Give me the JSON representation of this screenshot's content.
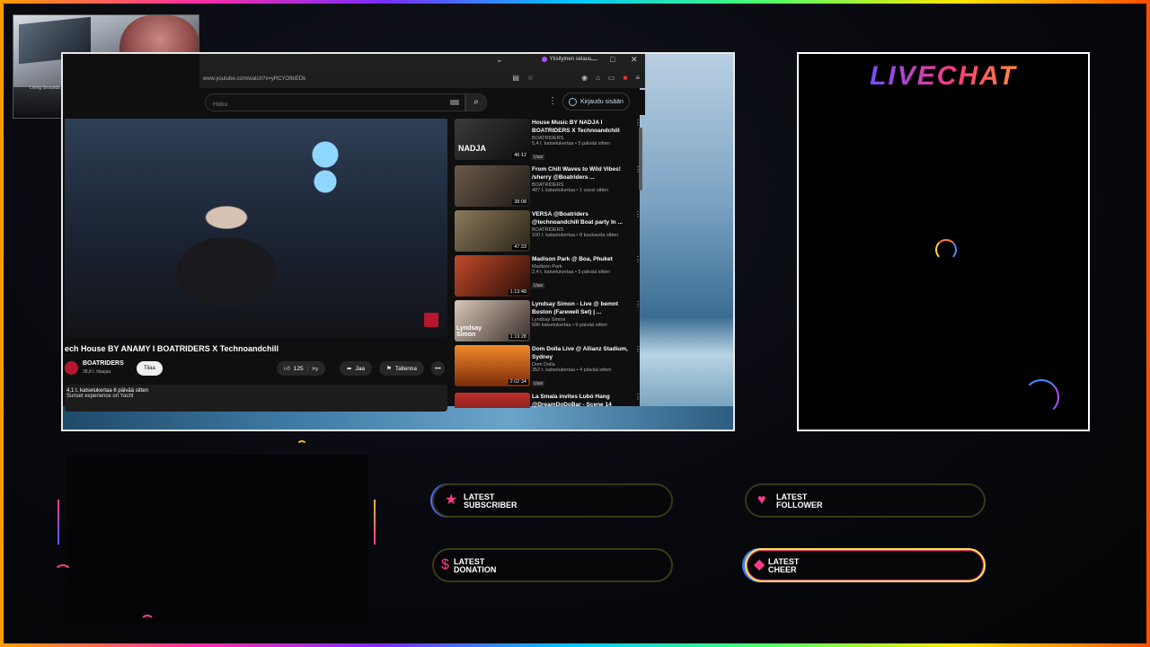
{
  "webcam": {
    "caption": "Living Grounds"
  },
  "browser": {
    "title_bar": {
      "private_label": "Yksityinen selaus",
      "minimize": "—",
      "maximize": "□",
      "close": "✕"
    },
    "address": {
      "url": "www.youtube.com/watch?v=yRCYOfbIEDk"
    },
    "search": {
      "placeholder": "Haku"
    },
    "signin_label": "Kirjaudu sisään",
    "video": {
      "title": "ech House BY ANAMY I BOATRIDERS X Technoandchill",
      "channel": "BOATRIDERS",
      "subscribers": "38,8 t. tilaajaa",
      "subscribe_label": "Tilaa",
      "likes": "125",
      "share_label": "Jaa",
      "save_label": "Tallenna",
      "more_label": "•••",
      "description_meta": "4,1 t. katselukertaa  6 päivää sitten",
      "description_text": "Sunset experience on Yacht"
    },
    "recommendations": [
      {
        "title": "House Music BY NADJA I BOATRIDERS X Technoandchill",
        "channel": "BOATRIDERS",
        "meta": "5,4 t. katselukertaa • 5 päivää sitten",
        "badge": "Uusi",
        "duration": "46:12",
        "thumb_text": "NADJA"
      },
      {
        "title": "From Chill Waves to Wild Vibes! /sherry @Boatriders ...",
        "channel": "BOATRIDERS",
        "meta": "407 t. katselukertaa • 1 vuosi sitten",
        "badge": "",
        "duration": "38:08",
        "thumb_text": ""
      },
      {
        "title": "VERSA @Boatriders @technoandchill Boat party In ...",
        "channel": "BOATRIDERS",
        "meta": "100 t. katselukertaa • 8 kuukautta sitten",
        "badge": "",
        "duration": "47:33",
        "thumb_text": ""
      },
      {
        "title": "Madison Park @ Boa, Phuket",
        "channel": "Madison Park",
        "meta": "2,4 t. katselukertaa • 5 päivää sitten",
        "badge": "Uusi",
        "duration": "1:13:48",
        "thumb_text": ""
      },
      {
        "title": "Lyndsay Simon - Live @ bemnt Boston (Farewell Set) | ...",
        "channel": "Lyndsay Simon",
        "meta": "596 katselukertaa • 9 päivää sitten",
        "badge": "",
        "duration": "1:19:28",
        "thumb_text": "Lyndsay Simon"
      },
      {
        "title": "Dom Dolla Live @ Allianz Stadium, Sydney",
        "channel": "Dom Dolla",
        "meta": "352 t. katselukertaa • 4 päivää sitten",
        "badge": "Uusi",
        "duration": "2:02:34",
        "thumb_text": ""
      },
      {
        "title": "La Smala invites Lubó Hang @DreamDoDoBar - Scene 14",
        "channel": "",
        "meta": "",
        "badge": "",
        "duration": "",
        "thumb_text": ""
      }
    ]
  },
  "livechat": {
    "title": "LIVECHAT"
  },
  "alerts": {
    "subscriber": {
      "line1": "LATEST",
      "line2": "SUBSCRIBER",
      "icon": "star-icon",
      "color": "#ff3b8a"
    },
    "follower": {
      "line1": "LATEST",
      "line2": "FOLLOWER",
      "icon": "heart-icon",
      "color": "#ff3b8a"
    },
    "donation": {
      "line1": "LATEST",
      "line2": "DONATION",
      "icon": "dollar-icon",
      "color": "#ff3b8a"
    },
    "cheer": {
      "line1": "LATEST",
      "line2": "CHEER",
      "icon": "diamond-icon",
      "color": "#ff3b8a"
    }
  },
  "colors": {
    "frame_gradient": [
      "#ff9d00",
      "#ff2ea0",
      "#7a2cff",
      "#00c8ff",
      "#4dff6a",
      "#ffe600"
    ],
    "accent": "#ff3b8a"
  }
}
